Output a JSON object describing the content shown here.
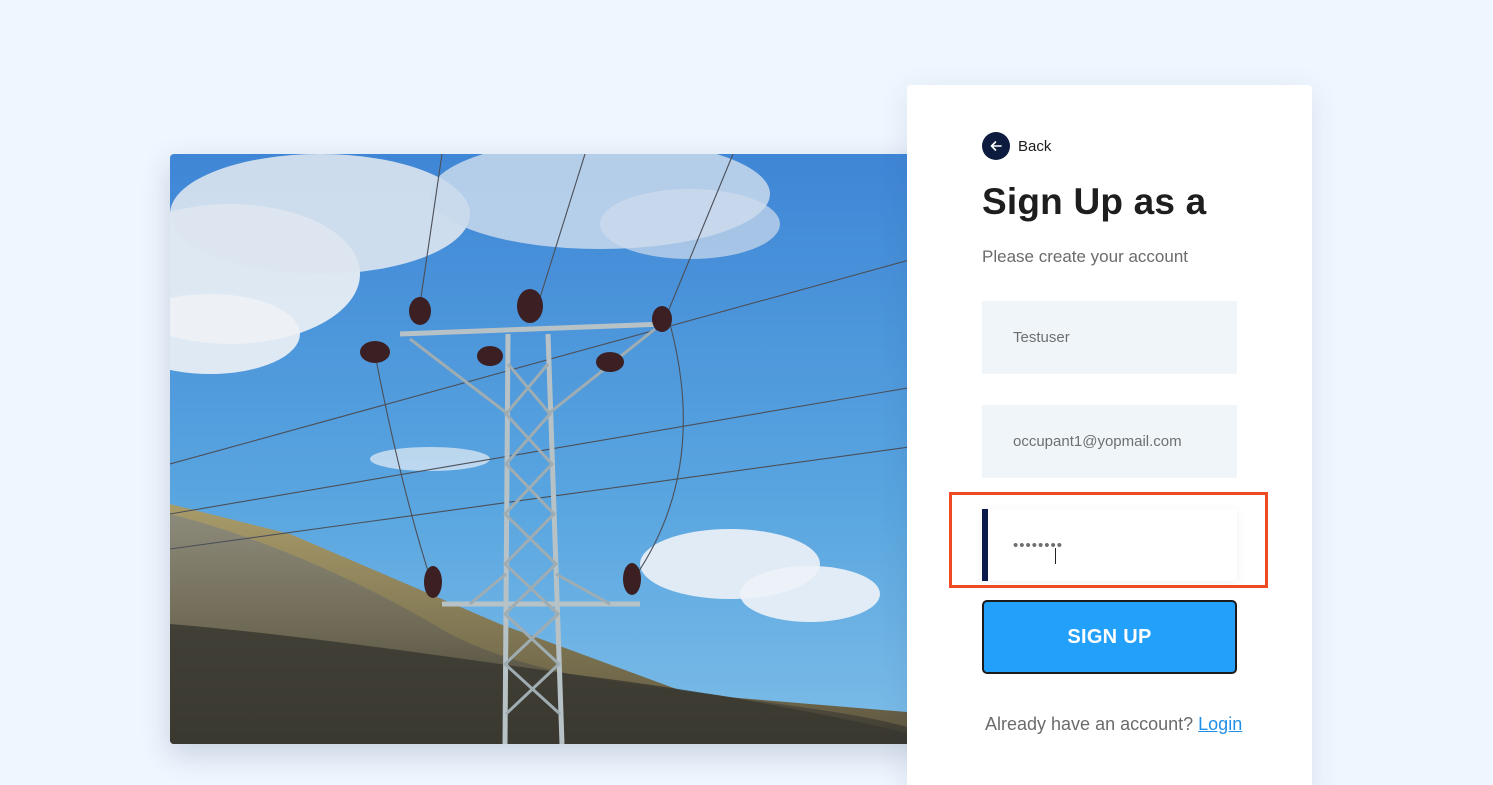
{
  "hero": {
    "image": "power-transmission-tower-photo"
  },
  "card": {
    "back_label": "Back",
    "back_icon": "arrow-left-icon",
    "title": "Sign Up as a",
    "subtitle": "Please create your account",
    "fields": {
      "username_value": "Testuser",
      "email_value": "occupant1@yopmail.com",
      "password_value": "••••••••"
    },
    "signup_label": "SIGN UP",
    "footer_text": "Already have an account?",
    "login_label": "Login"
  },
  "colors": {
    "background": "#eff6ff",
    "primary_button": "#23a0fa",
    "dark_accent": "#0a1a4a",
    "link": "#1f8fe8",
    "highlight": "#ee4a24"
  }
}
